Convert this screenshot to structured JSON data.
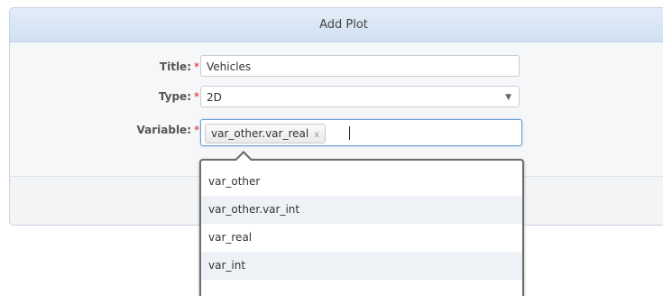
{
  "dialog": {
    "title": "Add Plot"
  },
  "form": {
    "title_label": "Title:",
    "title_value": "Vehicles",
    "type_label": "Type:",
    "type_value": "2D",
    "variable_label": "Variable:",
    "required_mark": "*",
    "selected_chip": "var_other.var_real",
    "chip_remove": "x",
    "arrow_glyph": "▼"
  },
  "dropdown": {
    "items": [
      "var_other",
      "var_other.var_int",
      "var_real",
      "var_int"
    ]
  },
  "colors": {
    "header": "#dbe7f5",
    "focus_border": "#6da0d6",
    "required": "#e02020"
  }
}
